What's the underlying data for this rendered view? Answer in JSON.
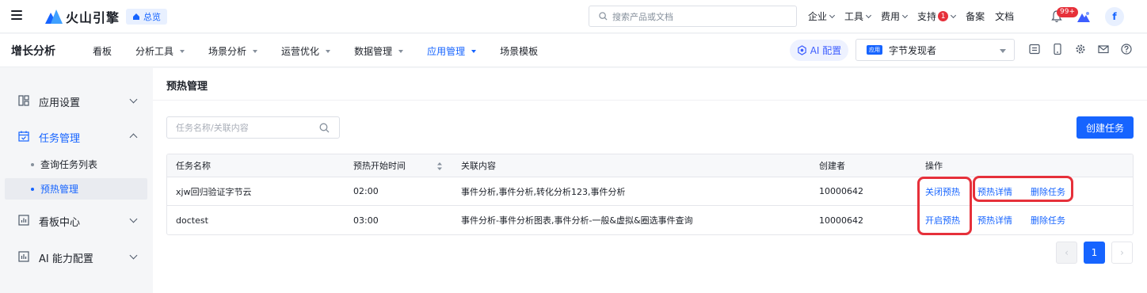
{
  "topbar": {
    "brand": "火山引擎",
    "overview": "总览",
    "search_placeholder": "搜索产品或文档",
    "nav": [
      {
        "label": "企业",
        "dropdown": true
      },
      {
        "label": "工具",
        "dropdown": true
      },
      {
        "label": "费用",
        "dropdown": true
      },
      {
        "label": "支持",
        "badge": "1",
        "dropdown": true
      },
      {
        "label": "备案"
      },
      {
        "label": "文档"
      }
    ],
    "bell_badge": "99+",
    "avatar": "f"
  },
  "subbar": {
    "product": "增长分析",
    "nav": [
      "看板",
      "分析工具",
      "场景分析",
      "运营优化",
      "数据管理",
      "应用管理",
      "场景模板"
    ],
    "ai_button": "AI 配置",
    "app_tag": "应用",
    "app_name": "字节发现者"
  },
  "sidebar": {
    "groups": [
      {
        "label": "应用设置",
        "icon": "layout-icon"
      },
      {
        "label": "任务管理",
        "icon": "calendar-icon",
        "expanded": true
      },
      {
        "label": "看板中心",
        "icon": "dashboard-icon"
      },
      {
        "label": "AI 能力配置",
        "icon": "ai-config-icon"
      }
    ],
    "sub_items": [
      "查询任务列表",
      "预热管理"
    ]
  },
  "main": {
    "title": "预热管理",
    "search_placeholder": "任务名称/关联内容",
    "create_button": "创建任务",
    "table": {
      "headers": [
        "任务名称",
        "预热开始时间",
        "关联内容",
        "创建者",
        "操作"
      ],
      "rows": [
        {
          "name": "xjw回归验证字节云",
          "time": "02:00",
          "content": "事件分析,事件分析,转化分析123,事件分析",
          "creator": "10000642",
          "actions": [
            "关闭预热",
            "预热详情",
            "删除任务"
          ]
        },
        {
          "name": "doctest",
          "time": "03:00",
          "content": "事件分析-事件分析图表,事件分析-一般&虚拟&圈选事件查询",
          "creator": "10000642",
          "actions": [
            "开启预热",
            "预热详情",
            "删除任务"
          ]
        }
      ]
    },
    "pagination": {
      "current": "1"
    }
  },
  "colors": {
    "accent": "#1664ff",
    "highlight": "#e6303a"
  }
}
